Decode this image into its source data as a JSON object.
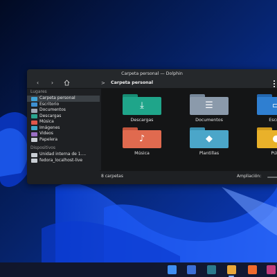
{
  "window": {
    "title": "Carpeta personal — Dolphin"
  },
  "toolbar": {
    "back_icon": "chevron-left-icon",
    "forward_icon": "chevron-right-icon",
    "home_icon": "home-icon",
    "breadcrumb_separator": ">",
    "breadcrumb": "Carpeta personal"
  },
  "sidebar": {
    "places_heading": "Lugares",
    "places": [
      {
        "label": "Carpeta personal",
        "icon": "home-folder-icon",
        "color": "#3fa3d6",
        "active": true
      },
      {
        "label": "Escritorio",
        "icon": "desktop-icon",
        "color": "#3d8fd1"
      },
      {
        "label": "Documentos",
        "icon": "documents-icon",
        "color": "#a0a8b4"
      },
      {
        "label": "Descargas",
        "icon": "downloads-icon",
        "color": "#2aa58f"
      },
      {
        "label": "Música",
        "icon": "music-icon",
        "color": "#e0574a"
      },
      {
        "label": "Imágenes",
        "icon": "pictures-icon",
        "color": "#40a9c9"
      },
      {
        "label": "Videos",
        "icon": "videos-icon",
        "color": "#9b6fc4"
      },
      {
        "label": "Papelera",
        "icon": "trash-icon",
        "color": "#c9ced4"
      }
    ],
    "devices_heading": "Dispositivos",
    "devices": [
      {
        "label": "Unidad interna de 1....",
        "icon": "drive-icon",
        "color": "#c9ced4"
      },
      {
        "label": "fedora_localhost-live",
        "icon": "drive-icon",
        "color": "#c9ced4"
      }
    ]
  },
  "files": [
    {
      "label": "Descargas",
      "icon": "download-arrow-icon",
      "glyph": "⤓",
      "color": "#1fa58a",
      "tab": "#178c74"
    },
    {
      "label": "Documentos",
      "icon": "document-lines-icon",
      "glyph": "☰",
      "color": "#8b9aab",
      "tab": "#76879a"
    },
    {
      "label": "Escrito",
      "icon": "desktop-icon",
      "glyph": "▭",
      "color": "#2f7fd1",
      "tab": "#2367b0"
    },
    {
      "label": "Música",
      "icon": "music-note-icon",
      "glyph": "♪",
      "color": "#e06a4f",
      "tab": "#c3553d"
    },
    {
      "label": "Plantillas",
      "icon": "template-cube-icon",
      "glyph": "◆",
      "color": "#4ba6c9",
      "tab": "#3a8fb0"
    },
    {
      "label": "Públi",
      "icon": "person-icon",
      "glyph": "●",
      "color": "#e9b12a",
      "tab": "#cf9a1d"
    }
  ],
  "status": {
    "count_text": "8 carpetas",
    "zoom_label": "Ampliación:",
    "zoom_level": 0.6
  },
  "taskbar": {
    "apps": [
      {
        "icon": "start-menu-icon",
        "color": "#3f8ef2"
      },
      {
        "icon": "discover-icon",
        "color": "#3b6fd6"
      },
      {
        "icon": "system-settings-icon",
        "color": "#2c7a8c"
      },
      {
        "icon": "dolphin-folder-icon",
        "color": "#e8a73a",
        "active": true
      },
      {
        "icon": "firefox-icon",
        "color": "#f06a2c"
      },
      {
        "icon": "app-icon",
        "color": "#c43b7a"
      }
    ]
  }
}
